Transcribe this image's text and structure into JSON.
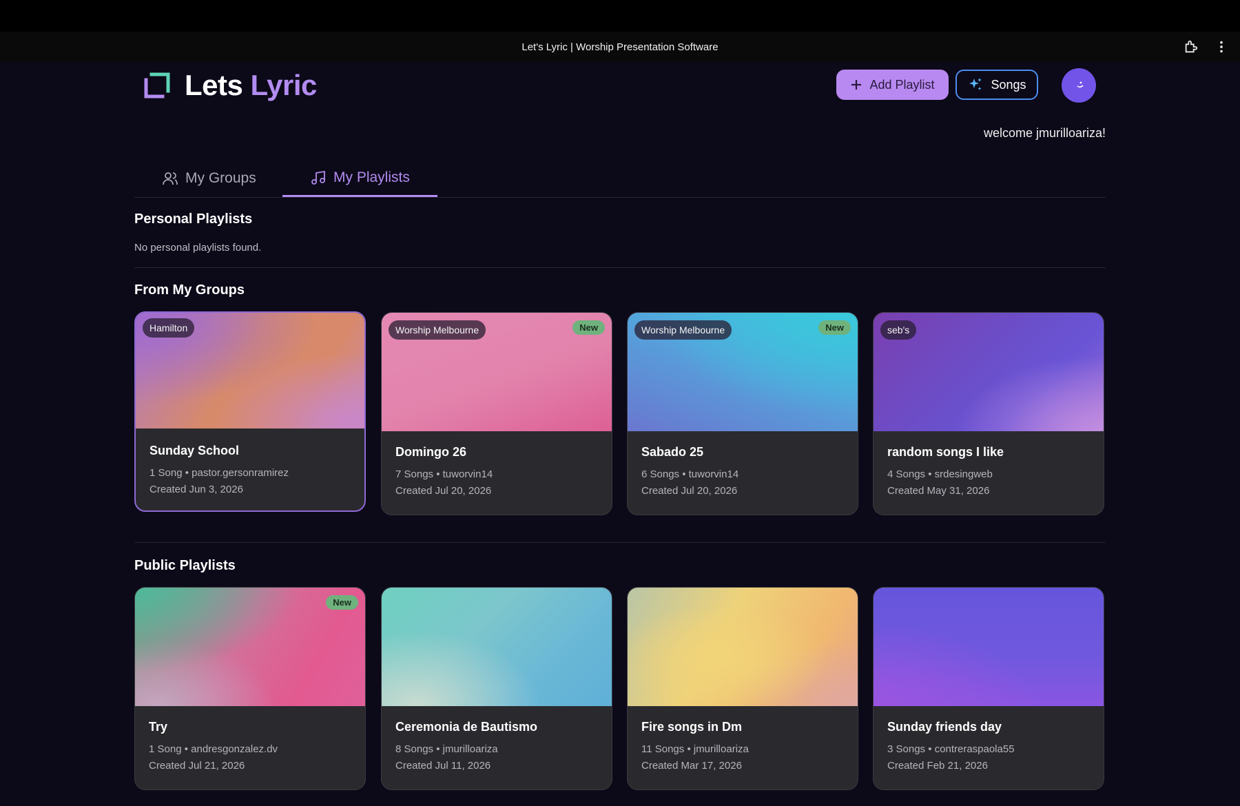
{
  "window": {
    "title": "Let's Lyric | Worship Presentation Software"
  },
  "app": {
    "logo_word1": "Lets",
    "logo_word2": "Lyric"
  },
  "header": {
    "add_playlist_label": "Add Playlist",
    "songs_label": "Songs",
    "welcome": "welcome jmurilloariza!"
  },
  "tabs": [
    {
      "label": "My Groups",
      "active": false
    },
    {
      "label": "My Playlists",
      "active": true
    }
  ],
  "personal": {
    "title": "Personal Playlists",
    "empty_text": "No personal playlists found."
  },
  "groups_section": {
    "title": "From My Groups",
    "cards": [
      {
        "group": "Hamilton",
        "is_new": false,
        "name": "Sunday School",
        "songs": "1 Song • pastor.gersonramirez",
        "created": "Created Jun 3, 2026"
      },
      {
        "group": "Worship Melbourne",
        "is_new": true,
        "new_label": "New",
        "name": "Domingo 26",
        "songs": "7 Songs • tuworvin14",
        "created": "Created Jul 20, 2026"
      },
      {
        "group": "Worship Melbourne",
        "is_new": true,
        "new_label": "New",
        "name": "Sabado 25",
        "songs": "6 Songs • tuworvin14",
        "created": "Created Jul 20, 2026"
      },
      {
        "group": "seb's",
        "is_new": false,
        "name": "random songs I like",
        "songs": "4 Songs • srdesingweb",
        "created": "Created May 31, 2026"
      }
    ]
  },
  "public_section": {
    "title": "Public Playlists",
    "cards": [
      {
        "is_new": true,
        "new_label": "New",
        "name": "Try",
        "songs": "1 Song • andresgonzalez.dv",
        "created": "Created Jul 21, 2026"
      },
      {
        "is_new": false,
        "name": "Ceremonia de Bautismo",
        "songs": "8 Songs • jmurilloariza",
        "created": "Created Jul 11, 2026"
      },
      {
        "is_new": false,
        "name": "Fire songs in Dm",
        "songs": "11 Songs • jmurilloariza",
        "created": "Created Mar 17, 2026"
      },
      {
        "is_new": false,
        "name": "Sunday friends day",
        "songs": "3 Songs • contreraspaola55",
        "created": "Created Feb 21, 2026"
      }
    ]
  },
  "colors": {
    "accent": "#b28cf0",
    "button_primary": "#b889f0",
    "songs_border": "#4c8ef2",
    "background": "#0c0918",
    "card": "#2a2a2e",
    "new_badge": "#6fb27d"
  }
}
